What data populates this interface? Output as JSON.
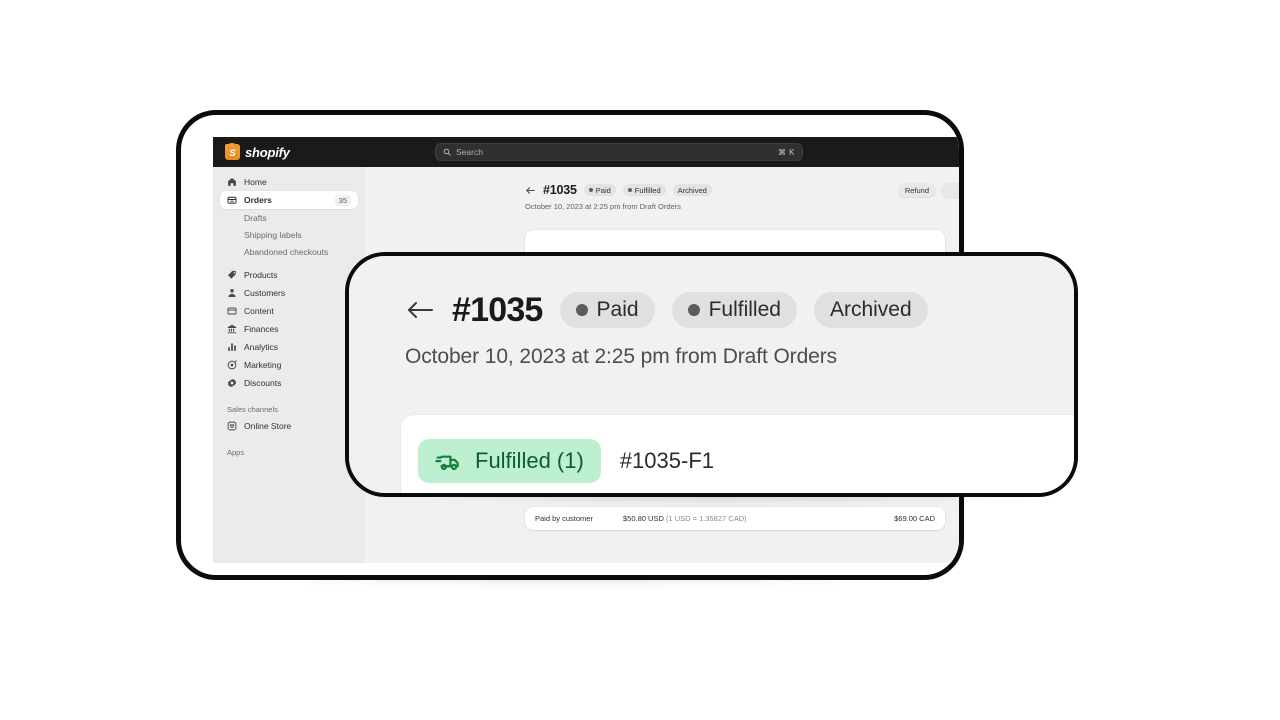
{
  "app": {
    "brand_name": "shopify",
    "brand_icon": "shopify-bag-icon"
  },
  "search": {
    "placeholder": "Search",
    "shortcut": "⌘ K",
    "icon": "search-icon"
  },
  "sidebar": {
    "items": [
      {
        "label": "Home",
        "icon": "home-icon",
        "count": ""
      },
      {
        "label": "Orders",
        "icon": "orders-icon",
        "count": "35"
      },
      {
        "label": "Drafts",
        "icon": "",
        "count": ""
      },
      {
        "label": "Shipping labels",
        "icon": "",
        "count": ""
      },
      {
        "label": "Abandoned checkouts",
        "icon": "",
        "count": ""
      },
      {
        "label": "Products",
        "icon": "products-tag-icon",
        "count": ""
      },
      {
        "label": "Customers",
        "icon": "customers-person-icon",
        "count": ""
      },
      {
        "label": "Content",
        "icon": "content-icon",
        "count": ""
      },
      {
        "label": "Finances",
        "icon": "finances-bank-icon",
        "count": ""
      },
      {
        "label": "Analytics",
        "icon": "analytics-bars-icon",
        "count": ""
      },
      {
        "label": "Marketing",
        "icon": "marketing-megaphone-icon",
        "count": ""
      },
      {
        "label": "Discounts",
        "icon": "discounts-gear-icon",
        "count": ""
      }
    ],
    "sales_channels_label": "Sales channels",
    "online_store_label": "Online Store",
    "online_store_icon": "online-store-icon",
    "apps_label": "Apps"
  },
  "order": {
    "back_icon": "back-arrow-icon",
    "number": "#1035",
    "badges": [
      {
        "label": "Paid",
        "has_dot": true
      },
      {
        "label": "Fulfilled",
        "has_dot": true
      },
      {
        "label": "Archived",
        "has_dot": false
      }
    ],
    "date_line": "October 10, 2023 at 2:25 pm from Draft Orders",
    "actions": [
      {
        "label": "Refund"
      }
    ],
    "fulfillment": {
      "badge_label": "Fulfilled (1)",
      "badge_icon": "delivery-truck-icon",
      "id": "#1035-F1",
      "menu_icon": "more-horizontal-icon",
      "menu_glyph": "···"
    },
    "payment": {
      "label": "Paid by customer",
      "detail_amount": "$50.80 USD",
      "detail_rate": "(1 USD = 1.35827 CAD)",
      "total": "$69.00 CAD"
    }
  },
  "magnifier": {
    "back_icon": "back-arrow-icon",
    "number": "#1035",
    "badges": [
      {
        "label": "Paid",
        "has_dot": true
      },
      {
        "label": "Fulfilled",
        "has_dot": true
      },
      {
        "label": "Archived",
        "has_dot": false
      }
    ],
    "date_line": "October 10, 2023 at 2:25 pm from Draft Orders",
    "fulfillment_badge_label": "Fulfilled (1)",
    "fulfillment_badge_icon": "delivery-truck-icon",
    "fulfillment_id": "#1035-F1"
  },
  "colors": {
    "topbar": "#1a1a1a",
    "sidebar": "#ebebeb",
    "canvas": "#f1f1f1",
    "card": "#ffffff",
    "frame_border": "#0b0b0b",
    "badge_neutral": "#e0e0e0",
    "badge_success_bg": "#bdf0d1",
    "badge_success_fg": "#0d5c33",
    "brand_orange": "#e88b24"
  }
}
